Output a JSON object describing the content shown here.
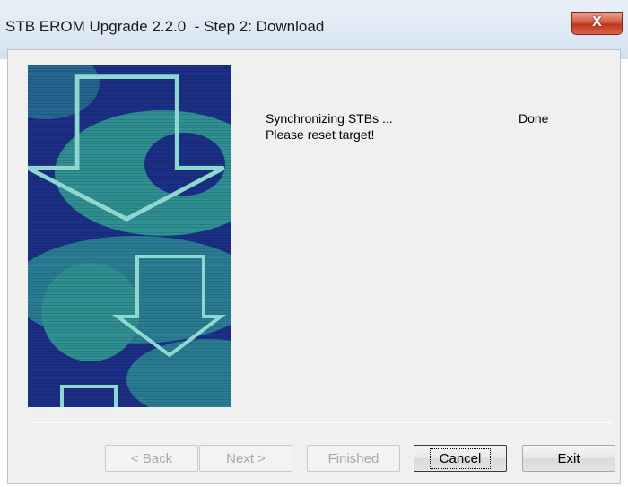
{
  "window": {
    "title": "STB EROM Upgrade 2.2.0  - Step 2: Download",
    "close_label": "X"
  },
  "status": {
    "line1": "Synchronizing STBs ...",
    "line1_result": "Done",
    "line2": "Please reset target!"
  },
  "buttons": {
    "back": "< Back",
    "next": "Next >",
    "finished": "Finished",
    "cancel": "Cancel",
    "exit": "Exit"
  },
  "colors": {
    "banner_dark": "#1c2f86",
    "banner_teal": "#2f8f92",
    "arrow_outline": "#8ed8cf"
  }
}
